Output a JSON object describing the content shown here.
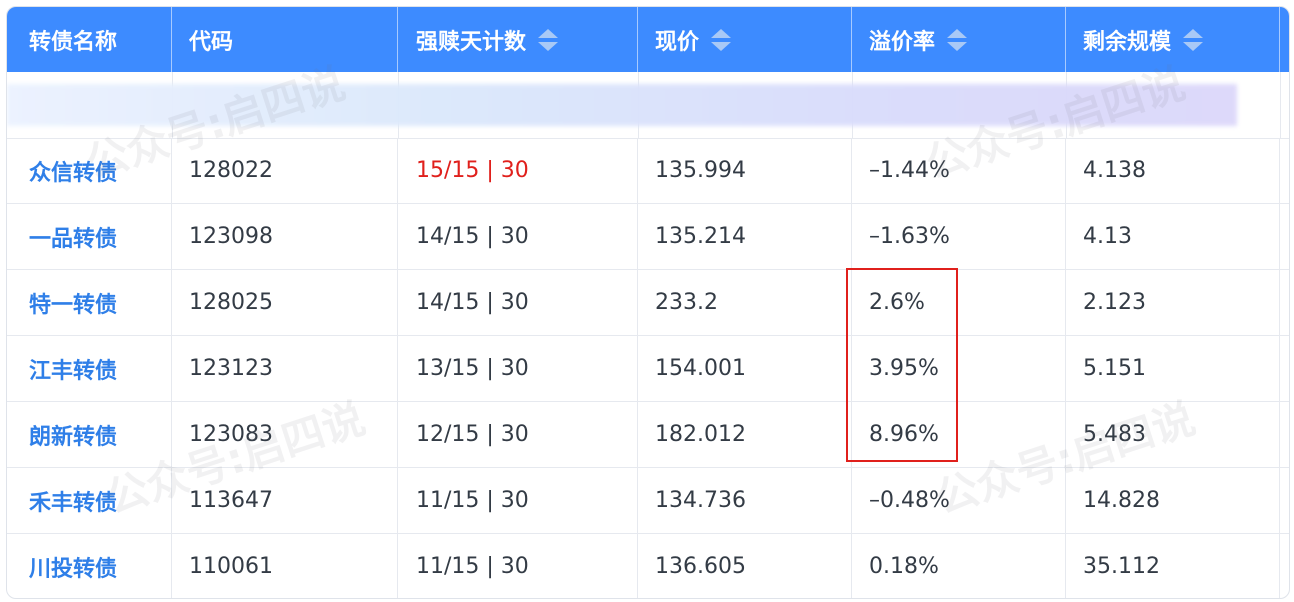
{
  "table": {
    "columns": [
      {
        "label": "转债名称",
        "sortable": false
      },
      {
        "label": "代码",
        "sortable": false
      },
      {
        "label": "强赎天计数",
        "sortable": true
      },
      {
        "label": "现价",
        "sortable": true
      },
      {
        "label": "溢价率",
        "sortable": true
      },
      {
        "label": "剩余规模",
        "sortable": true
      }
    ],
    "rows": [
      {
        "name": "众信转债",
        "code": "128022",
        "redeem_count": "15/15 | 30",
        "redeem_alert": true,
        "price": "135.994",
        "premium": "–1.44%",
        "scale": "4.138"
      },
      {
        "name": "一品转债",
        "code": "123098",
        "redeem_count": "14/15 | 30",
        "redeem_alert": false,
        "price": "135.214",
        "premium": "–1.63%",
        "scale": "4.13"
      },
      {
        "name": "特一转债",
        "code": "128025",
        "redeem_count": "14/15 | 30",
        "redeem_alert": false,
        "price": "233.2",
        "premium": "2.6%",
        "scale": "2.123"
      },
      {
        "name": "江丰转债",
        "code": "123123",
        "redeem_count": "13/15 | 30",
        "redeem_alert": false,
        "price": "154.001",
        "premium": "3.95%",
        "scale": "5.151"
      },
      {
        "name": "朗新转债",
        "code": "123083",
        "redeem_count": "12/15 | 30",
        "redeem_alert": false,
        "price": "182.012",
        "premium": "8.96%",
        "scale": "5.483"
      },
      {
        "name": "禾丰转债",
        "code": "113647",
        "redeem_count": "11/15 | 30",
        "redeem_alert": false,
        "price": "134.736",
        "premium": "–0.48%",
        "scale": "14.828"
      },
      {
        "name": "川投转债",
        "code": "110061",
        "redeem_count": "11/15 | 30",
        "redeem_alert": false,
        "price": "136.605",
        "premium": "0.18%",
        "scale": "35.112"
      }
    ]
  },
  "watermark": "公众号:启四说",
  "colors": {
    "header_bg": "#3d8bff",
    "name_link": "#2f7fe8",
    "alert_red": "#e0201c",
    "highlight_box": "#e0201c"
  }
}
